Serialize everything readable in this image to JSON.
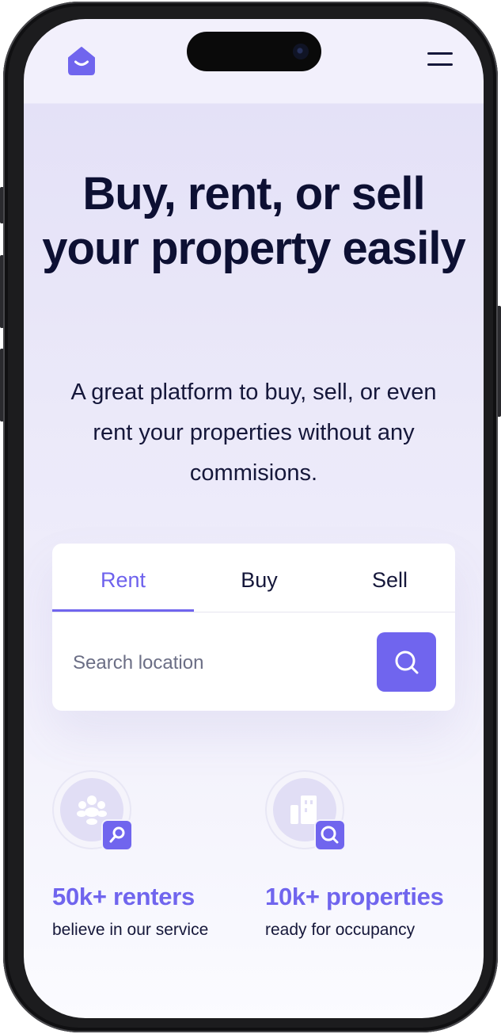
{
  "hero": {
    "title": "Buy, rent, or sell your property easily",
    "subtitle": "A great platform to buy, sell, or even rent your properties without any commisions."
  },
  "search": {
    "tabs": [
      "Rent",
      "Buy",
      "Sell"
    ],
    "active_tab": "Rent",
    "placeholder": "Search location",
    "value": ""
  },
  "stats": [
    {
      "value": "50k+ renters",
      "label": "believe in our service",
      "icon": "users-icon",
      "badge_icon": "key-icon"
    },
    {
      "value": "10k+ properties",
      "label": "ready for occupancy",
      "icon": "buildings-icon",
      "badge_icon": "search-icon"
    }
  ],
  "colors": {
    "accent": "#7065ee",
    "heading": "#0d1033",
    "text": "#15173a",
    "background": "#ebe9f9"
  }
}
